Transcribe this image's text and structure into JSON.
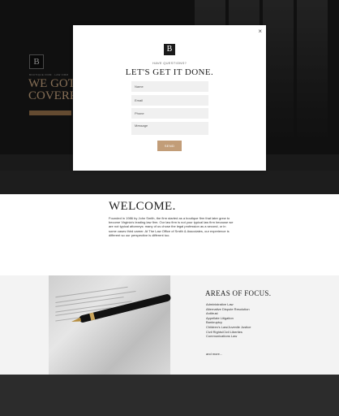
{
  "hero": {
    "logo_letter": "B",
    "small_text": "BOUTIQUE FIRM · LAW FIRM",
    "title": "WE GOT YOU\nCOVERED"
  },
  "modal": {
    "close_label": "×",
    "logo_letter": "B",
    "kicker": "HAVE QUESTIONS?",
    "title": "LET'S GET IT DONE.",
    "fields": {
      "name_placeholder": "Name",
      "email_placeholder": "Email",
      "phone_placeholder": "Phone",
      "message_placeholder": "Message"
    },
    "send_label": "SEND"
  },
  "welcome": {
    "title": "WELCOME.",
    "body": "Founded in 1986 by John Smith, the firm started as a boutique firm that later grew to become Virginia's leading law firm. Our law firm is not your typical law firm because we are not typical attorneys: many of us chose the legal profession as a second, or in some cases third career. At The Law Office of Smith & Associates, our experience is different so our perspective is different too."
  },
  "focus": {
    "title": "AREAS OF FOCUS.",
    "items": [
      "Administrative Law",
      "Alternative Dispute Resolution",
      "Antitrust",
      "Appellate Litigation",
      "Bankruptcy",
      "Children's Law/Juvenile Justice",
      "Civil Rights/Civil Liberties",
      "Communications Law"
    ],
    "more_label": "and more..."
  }
}
